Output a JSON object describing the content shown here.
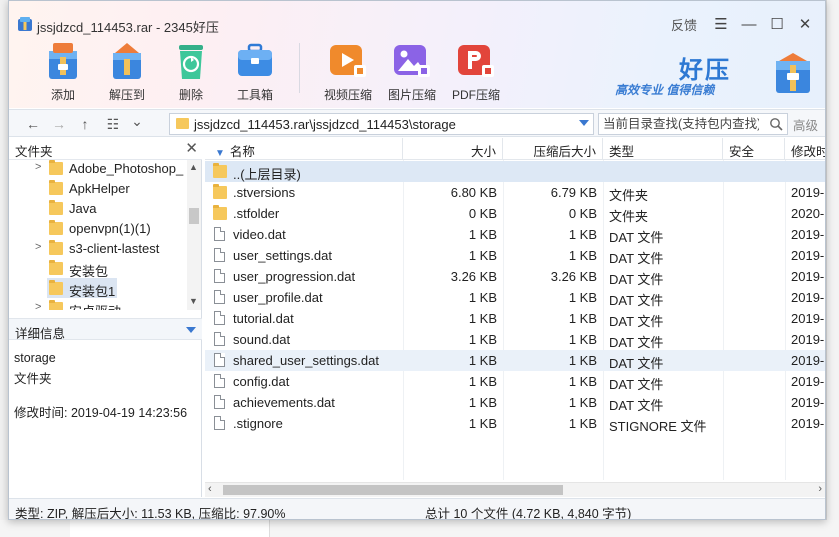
{
  "window": {
    "title": "jssjdzcd_114453.rar - 2345好压",
    "feedback": "反馈",
    "menu_glyph": "☰",
    "minimize_glyph": "—",
    "maximize_glyph": "☐",
    "close_glyph": "✕"
  },
  "toolbar": {
    "add": "添加",
    "extract_to": "解压到",
    "delete": "删除",
    "toolbox": "工具箱",
    "video_compress": "视频压缩",
    "image_compress": "图片压缩",
    "pdf_compress": "PDF压缩"
  },
  "brand": {
    "name": "好压",
    "slogan": "高效专业  值得信赖"
  },
  "address": {
    "path": "jssjdzcd_114453.rar\\jssjdzcd_114453\\storage",
    "search_placeholder": "当前目录查找(支持包内查找)",
    "advanced": "高级",
    "back_glyph": "←",
    "forward_glyph": "→",
    "up_glyph": "↑",
    "view_glyph": "☷",
    "view_drop_glyph": "⌄"
  },
  "left_panel": {
    "title": "文件夹",
    "close_glyph": "✕",
    "tree": [
      {
        "name": "Adobe_Photoshop_",
        "expandable": true,
        "selected": false
      },
      {
        "name": "ApkHelper",
        "expandable": false,
        "selected": false
      },
      {
        "name": "Java",
        "expandable": false,
        "selected": false
      },
      {
        "name": "openvpn(1)(1)",
        "expandable": false,
        "selected": false
      },
      {
        "name": "s3-client-lastest",
        "expandable": true,
        "selected": false
      },
      {
        "name": "安装包",
        "expandable": false,
        "selected": false
      },
      {
        "name": "安装包1",
        "expandable": false,
        "selected": true
      },
      {
        "name": "安卓驱动",
        "expandable": true,
        "selected": false
      }
    ],
    "detail_title": "详细信息",
    "detail_name": "storage",
    "detail_type": "文件夹",
    "detail_modified": "修改时间:  2019-04-19 14:23:56"
  },
  "file_list": {
    "columns": {
      "name": "名称",
      "size": "大小",
      "packed": "压缩后大小",
      "type": "类型",
      "security": "安全",
      "modified": "修改时"
    },
    "sort_glyph": "▼",
    "rows": [
      {
        "name": "..(上层目录)",
        "size": "",
        "packed": "",
        "type": "",
        "modified": "",
        "kind": "folder"
      },
      {
        "name": ".stversions",
        "size": "6.80 KB",
        "packed": "6.79 KB",
        "type": "文件夹",
        "modified": "2019-",
        "kind": "folder"
      },
      {
        "name": ".stfolder",
        "size": "0 KB",
        "packed": "0 KB",
        "type": "文件夹",
        "modified": "2020-",
        "kind": "folder"
      },
      {
        "name": "video.dat",
        "size": "1 KB",
        "packed": "1 KB",
        "type": "DAT 文件",
        "modified": "2019-",
        "kind": "file"
      },
      {
        "name": "user_settings.dat",
        "size": "1 KB",
        "packed": "1 KB",
        "type": "DAT 文件",
        "modified": "2019-",
        "kind": "file"
      },
      {
        "name": "user_progression.dat",
        "size": "3.26 KB",
        "packed": "3.26 KB",
        "type": "DAT 文件",
        "modified": "2019-",
        "kind": "file"
      },
      {
        "name": "user_profile.dat",
        "size": "1 KB",
        "packed": "1 KB",
        "type": "DAT 文件",
        "modified": "2019-",
        "kind": "file"
      },
      {
        "name": "tutorial.dat",
        "size": "1 KB",
        "packed": "1 KB",
        "type": "DAT 文件",
        "modified": "2019-",
        "kind": "file"
      },
      {
        "name": "sound.dat",
        "size": "1 KB",
        "packed": "1 KB",
        "type": "DAT 文件",
        "modified": "2019-",
        "kind": "file"
      },
      {
        "name": "shared_user_settings.dat",
        "size": "1 KB",
        "packed": "1 KB",
        "type": "DAT 文件",
        "modified": "2019-",
        "kind": "file"
      },
      {
        "name": "config.dat",
        "size": "1 KB",
        "packed": "1 KB",
        "type": "DAT 文件",
        "modified": "2019-",
        "kind": "file"
      },
      {
        "name": "achievements.dat",
        "size": "1 KB",
        "packed": "1 KB",
        "type": "DAT 文件",
        "modified": "2019-",
        "kind": "file"
      },
      {
        "name": ".stignore",
        "size": "1 KB",
        "packed": "1 KB",
        "type": "STIGNORE 文件",
        "modified": "2019-",
        "kind": "file"
      }
    ]
  },
  "status": {
    "left": "类型: ZIP, 解压后大小: 11.53 KB, 压缩比: 97.90%",
    "right": "总计 10 个文件 (4.72 KB, 4,840 字节)"
  },
  "colors": {
    "accent": "#3a78d0",
    "folder": "#f6c85c",
    "selection": "#dde8f5"
  }
}
